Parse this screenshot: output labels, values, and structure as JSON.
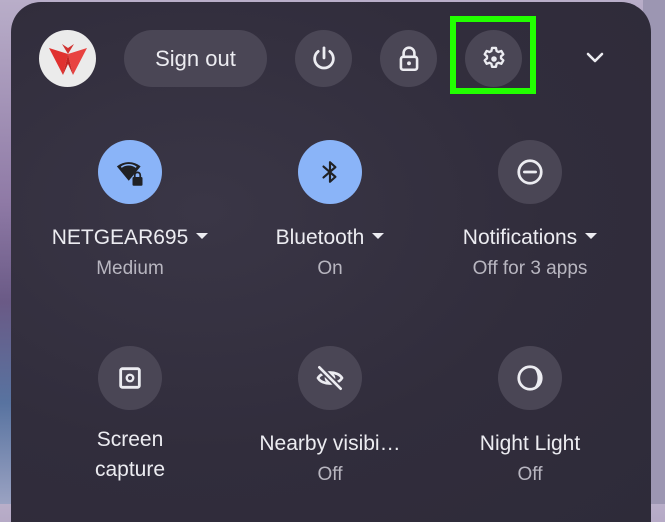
{
  "header": {
    "avatar_icon": "origami-bird-avatar",
    "sign_out_label": "Sign out",
    "buttons": [
      {
        "name": "power",
        "icon": "power-icon"
      },
      {
        "name": "lock",
        "icon": "lock-icon"
      },
      {
        "name": "settings",
        "icon": "gear-icon",
        "highlighted": true
      }
    ],
    "collapse_icon": "chevron-down-icon"
  },
  "colors": {
    "panel_bg": "#312d3c",
    "button_bg": "#4a4655",
    "active_tile": "#8ab4f8",
    "highlight": "#22ff00",
    "text": "#ececf1",
    "subtext": "#b8b6c0"
  },
  "tiles": [
    {
      "label": "NETGEAR695",
      "sublabel": "Medium",
      "icon": "wifi-lock-icon",
      "active": true,
      "dropdown": true
    },
    {
      "label": "Bluetooth",
      "sublabel": "On",
      "icon": "bluetooth-icon",
      "active": true,
      "dropdown": true
    },
    {
      "label": "Notifications",
      "sublabel": "Off for 3 apps",
      "icon": "do-not-disturb-icon",
      "active": false,
      "dropdown": true
    },
    {
      "label_line1": "Screen",
      "label_line2": "capture",
      "icon": "screen-capture-icon",
      "active": false
    },
    {
      "label": "Nearby visibi…",
      "sublabel": "Off",
      "icon": "eye-off-icon",
      "active": false
    },
    {
      "label": "Night Light",
      "sublabel": "Off",
      "icon": "night-light-icon",
      "active": false
    }
  ]
}
